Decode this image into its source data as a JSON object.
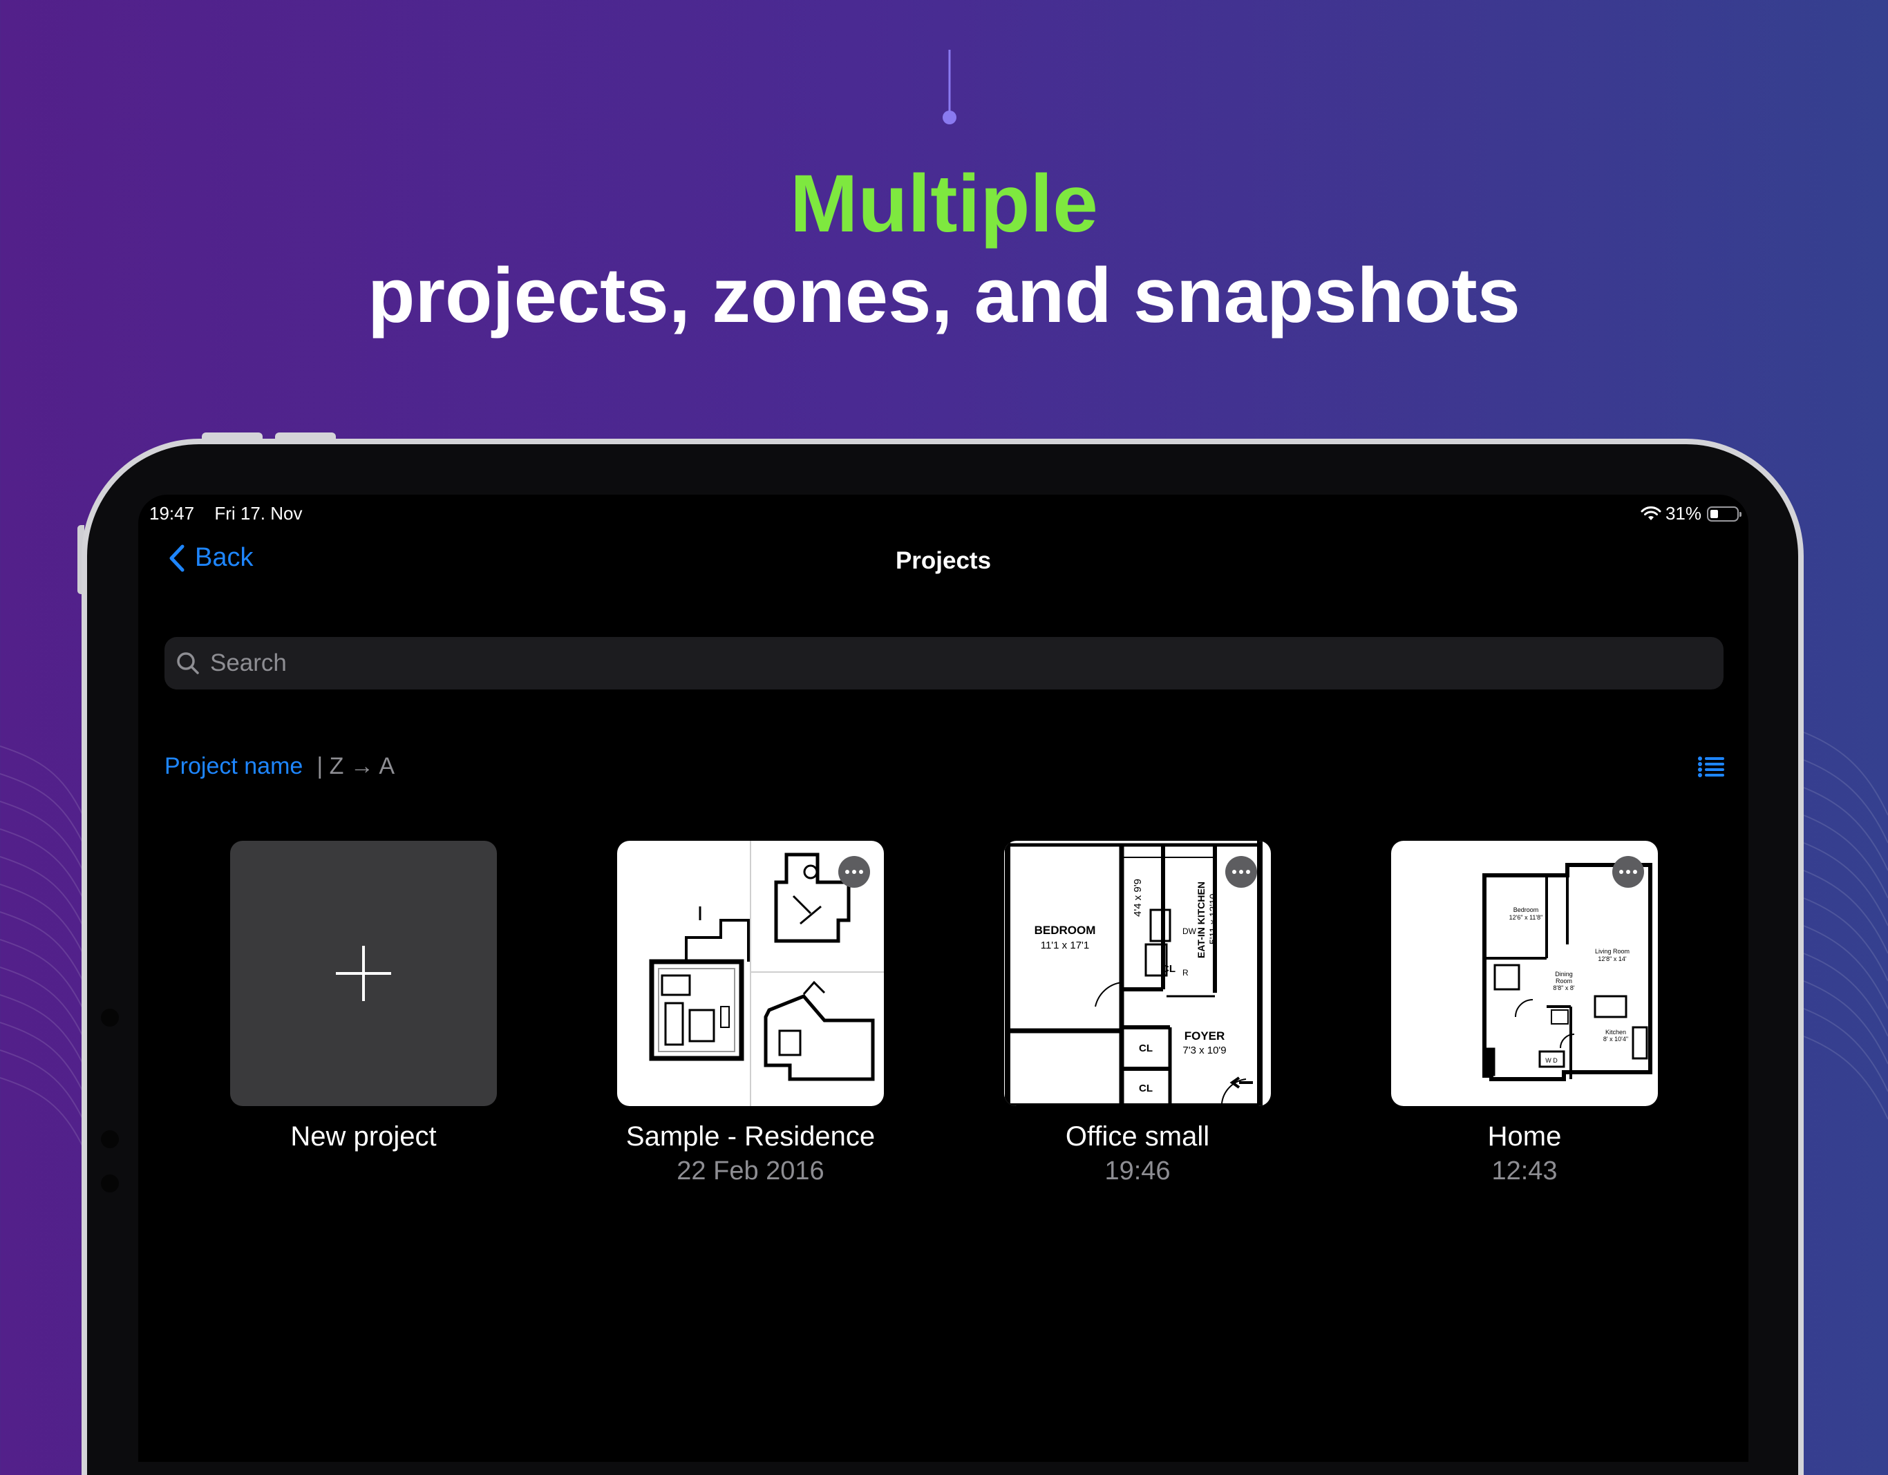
{
  "headline": {
    "highlight": "Multiple",
    "rest": "projects, zones, and snapshots",
    "highlight_color": "#7ee83f"
  },
  "status_bar": {
    "time": "19:47",
    "date": "Fri 17. Nov",
    "battery": "31%",
    "battery_level": 0.31,
    "wifi_icon": "wifi-icon"
  },
  "nav": {
    "back_label": "Back",
    "title": "Projects",
    "accent_color": "#1e86ff"
  },
  "search": {
    "placeholder": "Search"
  },
  "sort": {
    "key": "Project name",
    "order": "| Z → A"
  },
  "projects": [
    {
      "name": "New project",
      "date": "",
      "type": "new"
    },
    {
      "name": "Sample - Residence",
      "date": "22 Feb 2016",
      "type": "floorplan"
    },
    {
      "name": "Office small",
      "date": "19:46",
      "type": "floorplan"
    },
    {
      "name": "Home",
      "date": "12:43",
      "type": "floorplan"
    }
  ],
  "plan_labels": {
    "bedroom": "BEDROOM",
    "bedroom_size": "11'1 x 17'1",
    "bath_size": "4'4 x 9'9",
    "kitchen": "EAT-IN KITCHEN",
    "kitchen_size": "5'11 x 12'10",
    "foyer": "FOYER",
    "foyer_size": "7'3 x 10'9",
    "closet": "CL",
    "dw": "DW",
    "r": "R",
    "home_bedroom": "Bedroom",
    "home_bedroom_size": "12'6\" x 11'8\"",
    "living": "Living Room",
    "living_size": "12'8\" x 14'",
    "dining": "Dining",
    "dining_2": "Room",
    "dining_size": "8'8\" x 8'",
    "kitchen_small": "Kitchen",
    "kitchen_small_size": "8' x 10'4\"",
    "wd": "W D"
  }
}
